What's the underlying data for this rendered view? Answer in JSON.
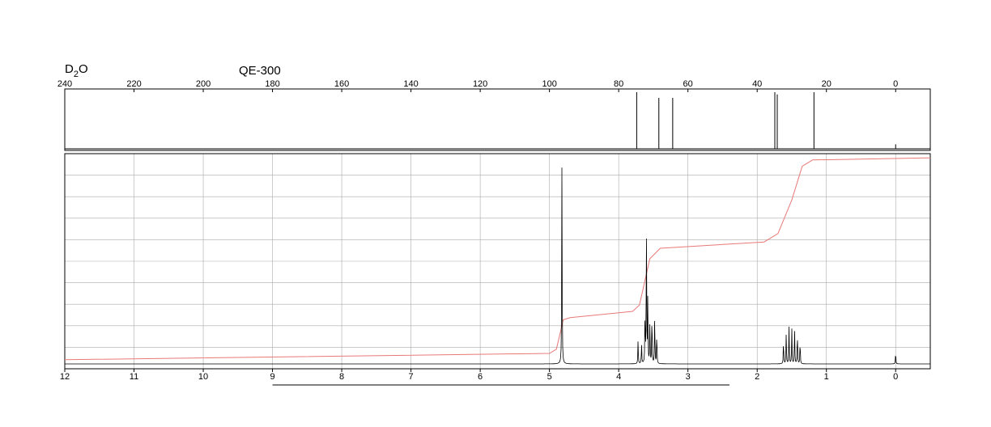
{
  "header": {
    "solvent_main": "D",
    "solvent_sub": "2",
    "solvent_tail": "O",
    "instrument": "QE-300"
  },
  "colors": {
    "trace": "#000000",
    "integral": "#e87878",
    "grid": "#aaaaaa",
    "frame": "#000000"
  },
  "chart_data": [
    {
      "type": "line",
      "title": "",
      "nucleus": "13C",
      "x_axis": {
        "range": [
          240,
          -10
        ],
        "reversed": true,
        "tick_values": [
          240,
          220,
          200,
          180,
          160,
          140,
          120,
          100,
          80,
          60,
          40,
          20,
          0
        ],
        "tick_labels": [
          "240",
          "220",
          "200",
          "180",
          "160",
          "140",
          "120",
          "100",
          "80",
          "60",
          "40",
          "20",
          "0"
        ]
      },
      "grid": false,
      "peaks": [
        {
          "ppm": 74.8,
          "height": 1.0
        },
        {
          "ppm": 68.4,
          "height": 0.9
        },
        {
          "ppm": 64.4,
          "height": 0.9
        },
        {
          "ppm": 34.9,
          "height": 1.0
        },
        {
          "ppm": 34.2,
          "height": 0.96
        },
        {
          "ppm": 23.6,
          "height": 1.0
        },
        {
          "ppm": 0.0,
          "height": 0.08
        }
      ]
    },
    {
      "type": "line",
      "title": "",
      "nucleus": "1H",
      "x_axis": {
        "range": [
          12,
          -0.5
        ],
        "reversed": true,
        "tick_values": [
          12,
          11,
          10,
          9,
          8,
          7,
          6,
          5,
          4,
          3,
          2,
          1,
          0
        ],
        "tick_labels": [
          "12",
          "11",
          "10",
          "9",
          "8",
          "7",
          "6",
          "5",
          "4",
          "3",
          "2",
          "1",
          "0"
        ]
      },
      "grid": true,
      "peaks": [
        {
          "ppm": 4.82,
          "height": 0.96
        },
        {
          "ppm": 3.72,
          "height": 0.12
        },
        {
          "ppm": 3.67,
          "height": 0.1
        },
        {
          "ppm": 3.62,
          "height": 0.24
        },
        {
          "ppm": 3.6,
          "height": 0.7
        },
        {
          "ppm": 3.58,
          "height": 0.32
        },
        {
          "ppm": 3.55,
          "height": 0.22
        },
        {
          "ppm": 3.52,
          "height": 0.26
        },
        {
          "ppm": 3.48,
          "height": 0.24
        },
        {
          "ppm": 3.45,
          "height": 0.16
        },
        {
          "ppm": 1.62,
          "height": 0.12
        },
        {
          "ppm": 1.58,
          "height": 0.16
        },
        {
          "ppm": 1.54,
          "height": 0.18
        },
        {
          "ppm": 1.5,
          "height": 0.17
        },
        {
          "ppm": 1.46,
          "height": 0.18
        },
        {
          "ppm": 1.42,
          "height": 0.16
        },
        {
          "ppm": 1.38,
          "height": 0.12
        },
        {
          "ppm": 0.0,
          "height": 0.06
        }
      ],
      "integral": [
        {
          "ppm": 12.0,
          "value": 0.02
        },
        {
          "ppm": 5.0,
          "value": 0.05
        },
        {
          "ppm": 4.9,
          "value": 0.07
        },
        {
          "ppm": 4.8,
          "value": 0.21
        },
        {
          "ppm": 4.7,
          "value": 0.22
        },
        {
          "ppm": 3.8,
          "value": 0.25
        },
        {
          "ppm": 3.7,
          "value": 0.28
        },
        {
          "ppm": 3.55,
          "value": 0.5
        },
        {
          "ppm": 3.4,
          "value": 0.55
        },
        {
          "ppm": 1.9,
          "value": 0.58
        },
        {
          "ppm": 1.7,
          "value": 0.62
        },
        {
          "ppm": 1.5,
          "value": 0.78
        },
        {
          "ppm": 1.35,
          "value": 0.94
        },
        {
          "ppm": 1.2,
          "value": 0.97
        },
        {
          "ppm": -0.5,
          "value": 0.98
        }
      ],
      "underline_range_ppm": [
        9.0,
        2.4
      ]
    }
  ]
}
